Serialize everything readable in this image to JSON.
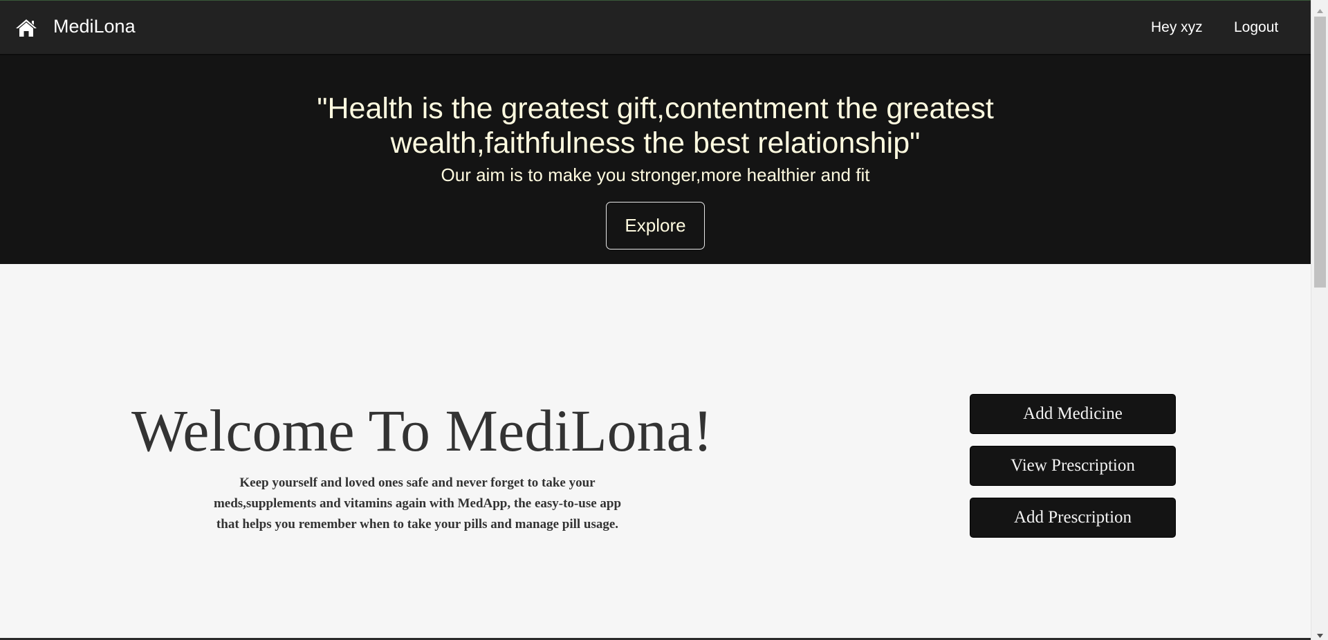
{
  "navbar": {
    "brand": "MediLona",
    "greeting": "Hey xyz",
    "logout_label": "Logout",
    "icon": "home-icon"
  },
  "hero": {
    "quote": "\"Health is the greatest gift,contentment the greatest wealth,faithfulness the best relationship\"",
    "aim": "Our aim is to make you stronger,more healthier and fit",
    "explore_label": "Explore"
  },
  "main": {
    "title": "Welcome To MediLona!",
    "description": "Keep yourself and loved ones safe and never forget to take your meds,supplements and vitamins again with MedApp, the easy-to-use app that helps you remember when to take your pills and manage pill usage."
  },
  "actions": {
    "add_medicine": "Add Medicine",
    "view_prescription": "View Prescription",
    "add_prescription": "Add Prescription"
  },
  "colors": {
    "navbar_bg": "#222222",
    "hero_bg": "#141414",
    "hero_text": "#fffbe0",
    "page_bg": "#f6f6f6",
    "button_bg": "#141414",
    "heading_text": "#333333"
  }
}
